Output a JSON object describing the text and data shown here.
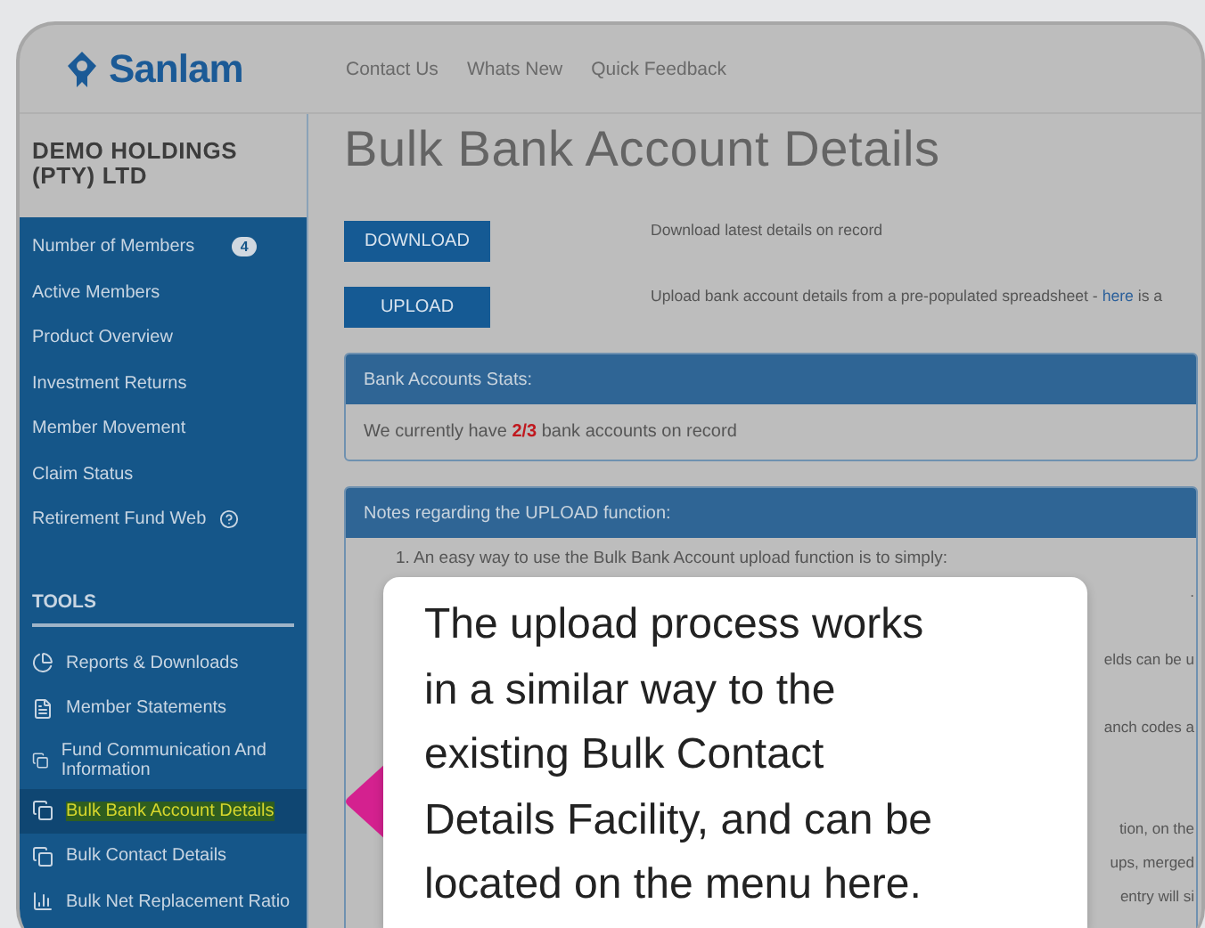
{
  "header": {
    "logo": "Sanlam",
    "nav": [
      "Contact Us",
      "Whats New",
      "Quick Feedback"
    ]
  },
  "sidebar": {
    "company": "DEMO HOLDINGS (PTY) LTD",
    "items": [
      {
        "label": "Number of Members",
        "badge": "4",
        "kind": "plain",
        "selected": false,
        "highlighted": false
      },
      {
        "label": "Active Members",
        "kind": "plain",
        "selected": false,
        "highlighted": false
      },
      {
        "label": "Product Overview",
        "kind": "plain",
        "selected": false,
        "highlighted": false
      },
      {
        "label": "Investment Returns",
        "kind": "plain",
        "selected": false,
        "highlighted": false
      },
      {
        "label": "Member Movement",
        "kind": "plain",
        "selected": false,
        "highlighted": false
      },
      {
        "label": "Claim Status",
        "kind": "plain",
        "selected": false,
        "highlighted": false
      },
      {
        "label": "Retirement Fund Web",
        "kind": "help",
        "selected": false,
        "highlighted": false
      }
    ],
    "tools_heading": "TOOLS",
    "tools": [
      {
        "label": "Reports & Downloads",
        "kind": "pie",
        "selected": false,
        "highlighted": false
      },
      {
        "label": "Member Statements",
        "kind": "document",
        "selected": false,
        "highlighted": false
      },
      {
        "label": "Fund Communication And Information",
        "kind": "copy",
        "selected": false,
        "highlighted": false
      },
      {
        "label": "Bulk Bank Account Details",
        "kind": "copy",
        "selected": true,
        "highlighted": true
      },
      {
        "label": "Bulk Contact Details",
        "kind": "copy",
        "selected": false,
        "highlighted": false
      },
      {
        "label": "Bulk Net Replacement Ratio",
        "kind": "chart",
        "selected": false,
        "highlighted": false
      }
    ]
  },
  "page_title": "Bulk Bank Account Details",
  "actions": [
    {
      "button": "DOWNLOAD",
      "description": "Download latest details on record"
    },
    {
      "button": "UPLOAD",
      "description": "Upload bank account details from a pre-populated spreadsheet - ",
      "link": "here",
      "description_end": " is a"
    }
  ],
  "stats_panel": {
    "title": "Bank Accounts Stats:",
    "text": "We currently have **2/3** bank accounts on record"
  },
  "notes_panel": {
    "title": "Notes regarding the UPLOAD function:",
    "lines": [
      "1. An easy way to use the Bulk Bank Account upload function is to simply:",
      ".",
      "elds can be u",
      "anch codes a",
      "tion, on the",
      "ups, merged",
      "entry will si"
    ]
  },
  "callout": {
    "lines": [
      "The upload process works",
      "in a similar way to the",
      "existing Bulk Contact",
      "Details Facility, and can be",
      "located on the menu here."
    ]
  }
}
